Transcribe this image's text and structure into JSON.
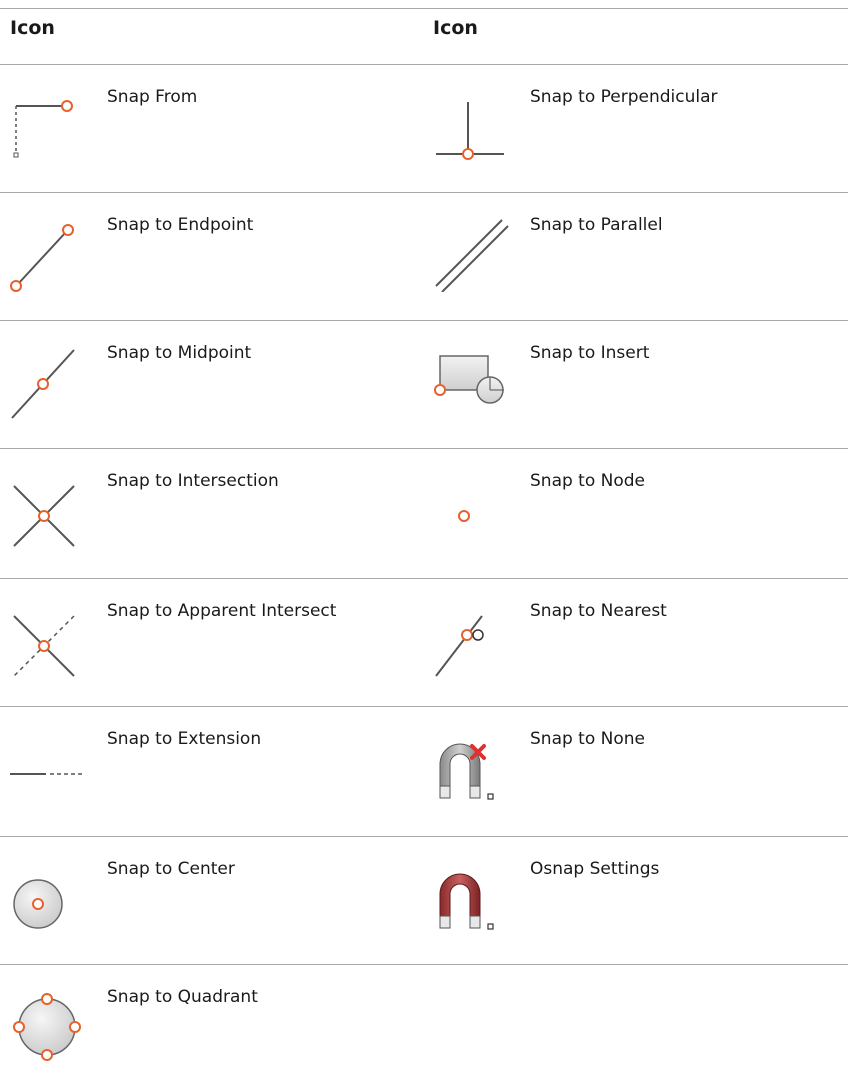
{
  "header": {
    "col1": "Icon",
    "col2": "Icon"
  },
  "rows": [
    {
      "left": {
        "label": "Snap From",
        "icon": "snap-from-icon"
      },
      "right": {
        "label": "Snap to Perpendicular",
        "icon": "snap-perpendicular-icon"
      }
    },
    {
      "left": {
        "label": "Snap to Endpoint",
        "icon": "snap-endpoint-icon"
      },
      "right": {
        "label": "Snap to Parallel",
        "icon": "snap-parallel-icon"
      }
    },
    {
      "left": {
        "label": "Snap to Midpoint",
        "icon": "snap-midpoint-icon"
      },
      "right": {
        "label": "Snap to Insert",
        "icon": "snap-insert-icon"
      }
    },
    {
      "left": {
        "label": "Snap to Intersection",
        "icon": "snap-intersection-icon"
      },
      "right": {
        "label": "Snap to Node",
        "icon": "snap-node-icon"
      }
    },
    {
      "left": {
        "label": "Snap to Apparent Intersect",
        "icon": "snap-apparent-intersect-icon"
      },
      "right": {
        "label": "Snap to Nearest",
        "icon": "snap-nearest-icon"
      }
    },
    {
      "left": {
        "label": "Snap to Extension",
        "icon": "snap-extension-icon"
      },
      "right": {
        "label": "Snap to None",
        "icon": "snap-none-magnet-icon"
      }
    },
    {
      "left": {
        "label": "Snap to Center",
        "icon": "snap-center-icon"
      },
      "right": {
        "label": "Osnap Settings",
        "icon": "osnap-settings-magnet-icon"
      }
    },
    {
      "left": {
        "label": "Snap to Quadrant",
        "icon": "snap-quadrant-icon"
      }
    }
  ],
  "colors": {
    "marker": "#e8602a",
    "line": "#555555",
    "divider": "#a9a9a9",
    "magnet": "#a33a3a"
  }
}
